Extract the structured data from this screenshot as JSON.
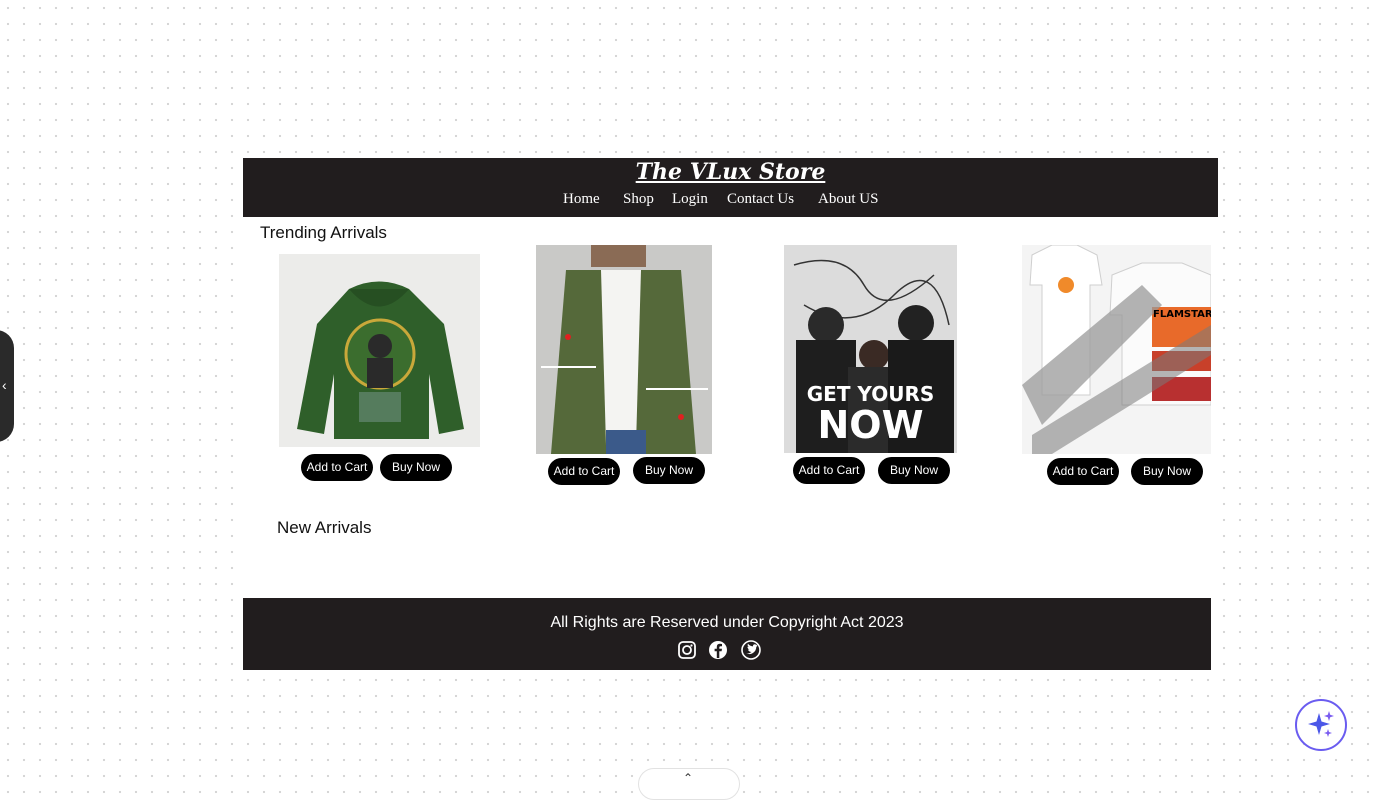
{
  "store": {
    "title": "The VLux Store",
    "nav": [
      {
        "label": "Home"
      },
      {
        "label": "Shop"
      },
      {
        "label": "Login"
      },
      {
        "label": "Contact Us"
      },
      {
        "label": "About US"
      }
    ]
  },
  "sections": {
    "trending_title": "Trending Arrivals",
    "new_title": "New Arrivals"
  },
  "products": [
    {
      "image": "green-hoodie-image",
      "add_label": "Add to Cart",
      "buy_label": "Buy Now"
    },
    {
      "image": "green-shirt-model-image",
      "add_label": "Add to Cart",
      "buy_label": "Buy Now"
    },
    {
      "image": "get-yours-now-poster-image",
      "poster_text_1": "GET YOURS",
      "poster_text_2": "NOW",
      "add_label": "Add to Cart",
      "buy_label": "Buy Now"
    },
    {
      "image": "flamstar-tshirt-image",
      "poster_text": "FLAMSTAR",
      "add_label": "Add to Cart",
      "buy_label": "Buy Now"
    }
  ],
  "footer": {
    "copyright": "All Rights are Reserved under Copyright Act 2023",
    "social": [
      "instagram-icon",
      "facebook-icon",
      "twitter-icon"
    ]
  },
  "overlay": {
    "left_tab_icon": "chevron-left-icon",
    "ai_icon": "sparkle-icon",
    "bottom_tab_icon": "chevron-up-icon"
  },
  "colors": {
    "header_bg": "#211d1e",
    "button_bg": "#000000",
    "accent": "#6a5cf0"
  }
}
